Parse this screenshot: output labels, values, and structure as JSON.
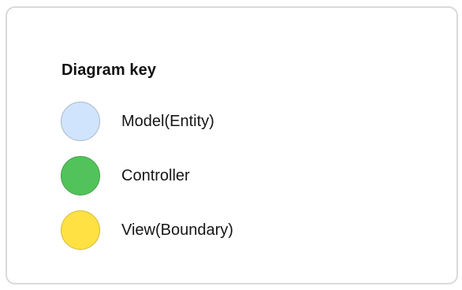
{
  "legend": {
    "title": "Diagram key",
    "items": [
      {
        "label": "Model(Entity)",
        "color": "#d0e5fd",
        "border": "#aab7c8"
      },
      {
        "label": "Controller",
        "color": "#52c35a",
        "border": "#44a14b"
      },
      {
        "label": "View(Boundary)",
        "color": "#ffe144",
        "border": "#d6bb37"
      }
    ]
  }
}
